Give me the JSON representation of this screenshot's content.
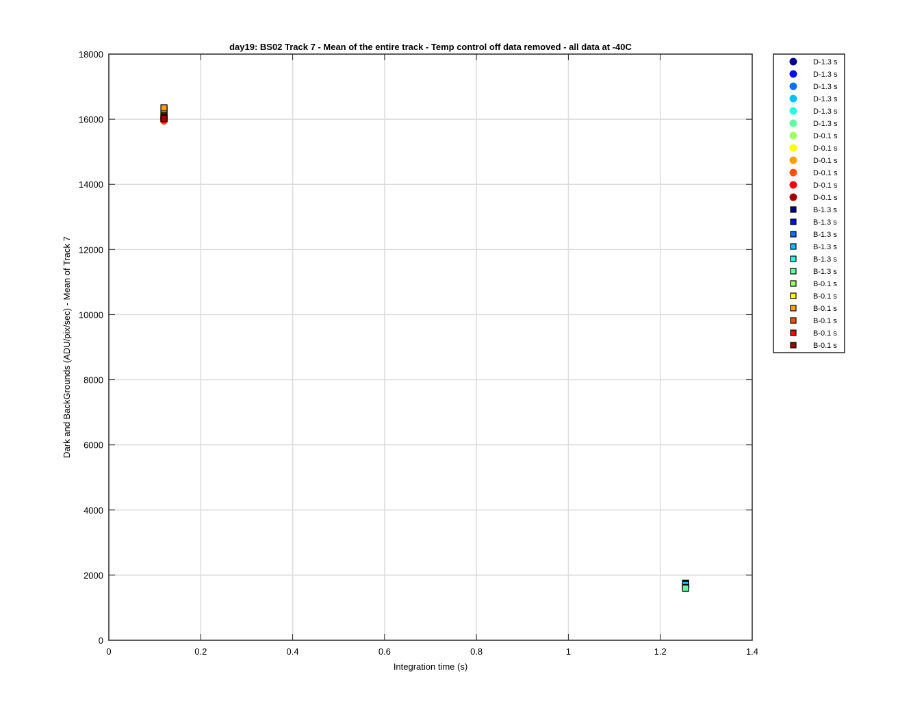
{
  "chart_data": {
    "type": "scatter",
    "title": "day19: BS02  Track 7 - Mean of the entire track - Temp control off data removed - all data at -40C",
    "xlabel": "Integration time (s)",
    "ylabel": "Dark and BackGrounds (ADU/pix/sec) - Mean of Track 7",
    "xlim": [
      0,
      1.4
    ],
    "ylim": [
      0,
      18000
    ],
    "xticks": [
      0,
      0.2,
      0.4,
      0.6,
      0.8,
      1.0,
      1.2,
      1.4
    ],
    "xtick_labels": [
      "0",
      "0.2",
      "0.4",
      "0.6",
      "0.8",
      "1",
      "1.2",
      "1.4"
    ],
    "yticks": [
      0,
      2000,
      4000,
      6000,
      8000,
      10000,
      12000,
      14000,
      16000,
      18000
    ],
    "ytick_labels": [
      "0",
      "2000",
      "4000",
      "6000",
      "8000",
      "10000",
      "12000",
      "14000",
      "16000",
      "18000"
    ],
    "grid": true,
    "legend_position": "outside-top-right",
    "series": [
      {
        "name": "D-1.3 s",
        "marker": "circle",
        "color": "#00008f",
        "x": 1.255,
        "y": 1650
      },
      {
        "name": "D-1.3 s",
        "marker": "circle",
        "color": "#0010ff",
        "x": 1.255,
        "y": 1660
      },
      {
        "name": "D-1.3 s",
        "marker": "circle",
        "color": "#0070ff",
        "x": 1.255,
        "y": 1640
      },
      {
        "name": "D-1.3 s",
        "marker": "circle",
        "color": "#00c0ff",
        "x": 1.255,
        "y": 1630
      },
      {
        "name": "D-1.3 s",
        "marker": "circle",
        "color": "#20ffdf",
        "x": 1.255,
        "y": 1620
      },
      {
        "name": "D-1.3 s",
        "marker": "circle",
        "color": "#60ff9f",
        "x": 1.255,
        "y": 1600
      },
      {
        "name": "D-0.1 s",
        "marker": "circle",
        "color": "#9fff60",
        "x": 0.12,
        "y": 16150
      },
      {
        "name": "D-0.1 s",
        "marker": "circle",
        "color": "#ffff00",
        "x": 0.12,
        "y": 16200
      },
      {
        "name": "D-0.1 s",
        "marker": "circle",
        "color": "#ffa000",
        "x": 0.12,
        "y": 16100
      },
      {
        "name": "D-0.1 s",
        "marker": "circle",
        "color": "#ff5000",
        "x": 0.12,
        "y": 15950
      },
      {
        "name": "D-0.1 s",
        "marker": "circle",
        "color": "#ff0000",
        "x": 0.12,
        "y": 16000
      },
      {
        "name": "D-0.1 s",
        "marker": "circle",
        "color": "#a00000",
        "x": 0.12,
        "y": 16050
      },
      {
        "name": "B-1.3 s",
        "marker": "square",
        "color": "#00008f",
        "x": 1.255,
        "y": 1750
      },
      {
        "name": "B-1.3 s",
        "marker": "square",
        "color": "#0010ff",
        "x": 1.255,
        "y": 1740
      },
      {
        "name": "B-1.3 s",
        "marker": "square",
        "color": "#0070ff",
        "x": 1.255,
        "y": 1720
      },
      {
        "name": "B-1.3 s",
        "marker": "square",
        "color": "#00c0ff",
        "x": 1.255,
        "y": 1710
      },
      {
        "name": "B-1.3 s",
        "marker": "square",
        "color": "#20ffdf",
        "x": 1.255,
        "y": 1620
      },
      {
        "name": "B-1.3 s",
        "marker": "square",
        "color": "#60ff9f",
        "x": 1.255,
        "y": 1600
      },
      {
        "name": "B-0.1 s",
        "marker": "square",
        "color": "#9fff60",
        "x": 0.12,
        "y": 16250
      },
      {
        "name": "B-0.1 s",
        "marker": "square",
        "color": "#ffff00",
        "x": 0.12,
        "y": 16300
      },
      {
        "name": "B-0.1 s",
        "marker": "square",
        "color": "#ffa000",
        "x": 0.12,
        "y": 16350
      },
      {
        "name": "B-0.1 s",
        "marker": "square",
        "color": "#ff5000",
        "x": 0.12,
        "y": 16080
      },
      {
        "name": "B-0.1 s",
        "marker": "square",
        "color": "#ff0000",
        "x": 0.12,
        "y": 16050
      },
      {
        "name": "B-0.1 s",
        "marker": "square",
        "color": "#a00000",
        "x": 0.12,
        "y": 16020
      }
    ]
  }
}
